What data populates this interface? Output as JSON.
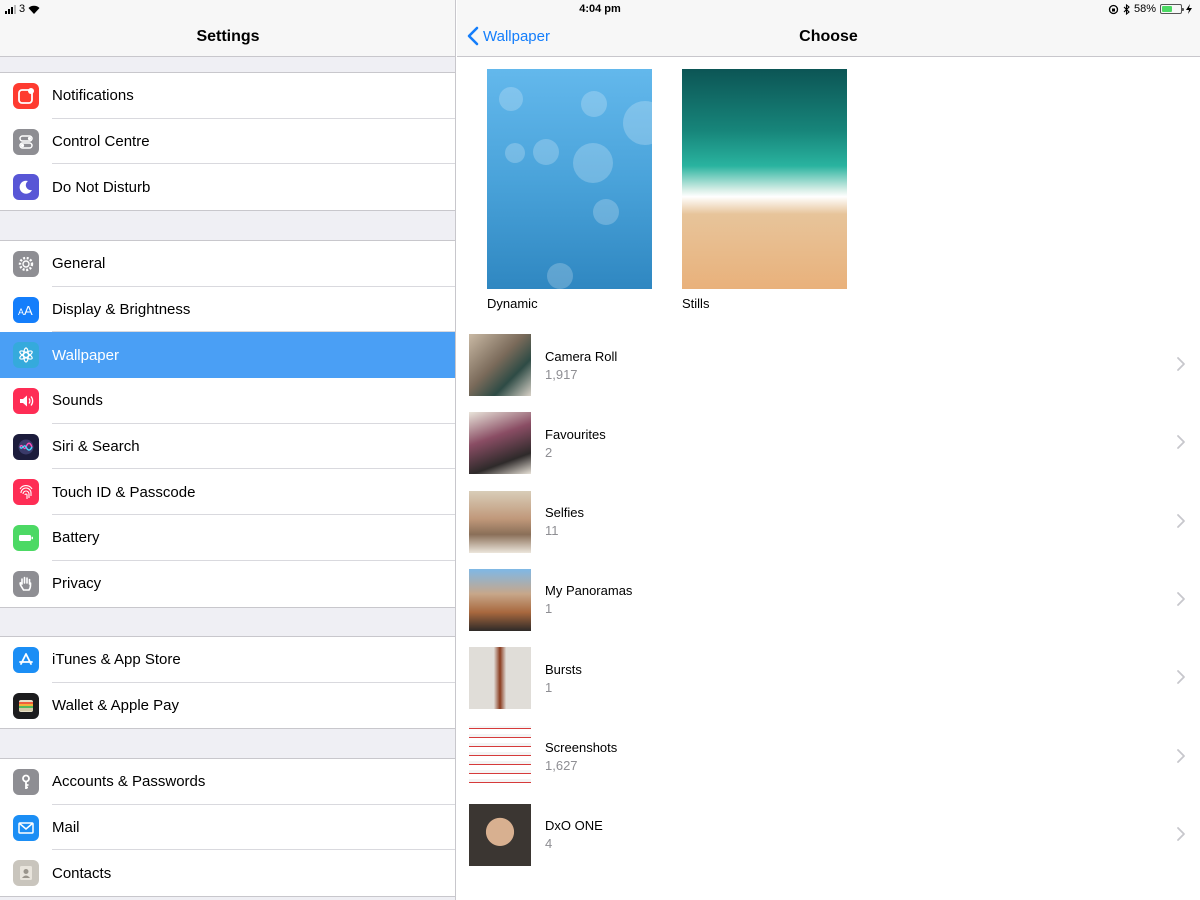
{
  "status": {
    "carrier": "3",
    "time": "4:04 pm",
    "battery": "58%",
    "battery_level": 0.58
  },
  "settings": {
    "title": "Settings",
    "groups": [
      [
        {
          "label": "Notifications",
          "icon": "notifications-icon",
          "color": "#fe3b30"
        },
        {
          "label": "Control Centre",
          "icon": "control-centre-icon",
          "color": "#8e8e93"
        },
        {
          "label": "Do Not Disturb",
          "icon": "moon-icon",
          "color": "#5856d6"
        }
      ],
      [
        {
          "label": "General",
          "icon": "gear-icon",
          "color": "#8e8e93"
        },
        {
          "label": "Display & Brightness",
          "icon": "text-size-icon",
          "color": "#147efb"
        },
        {
          "label": "Wallpaper",
          "icon": "wallpaper-flower-icon",
          "color": "#35aadc",
          "selected": true
        },
        {
          "label": "Sounds",
          "icon": "speaker-icon",
          "color": "#fe2d55"
        },
        {
          "label": "Siri & Search",
          "icon": "siri-icon",
          "color": "#1c1c3c"
        },
        {
          "label": "Touch ID & Passcode",
          "icon": "fingerprint-icon",
          "color": "#fe2d55"
        },
        {
          "label": "Battery",
          "icon": "battery-icon",
          "color": "#4cd964"
        },
        {
          "label": "Privacy",
          "icon": "hand-icon",
          "color": "#8e8e93"
        }
      ],
      [
        {
          "label": "iTunes & App Store",
          "icon": "app-store-icon",
          "color": "#1b8ef5"
        },
        {
          "label": "Wallet & Apple Pay",
          "icon": "wallet-icon",
          "color": "#1c1c1e"
        }
      ],
      [
        {
          "label": "Accounts & Passwords",
          "icon": "key-icon",
          "color": "#8e8e93"
        },
        {
          "label": "Mail",
          "icon": "envelope-icon",
          "color": "#1b8ef5"
        },
        {
          "label": "Contacts",
          "icon": "contacts-icon",
          "color": "#c9c5bd"
        }
      ]
    ]
  },
  "choose": {
    "back_label": "Wallpaper",
    "title": "Choose",
    "wallpapers": [
      {
        "label": "Dynamic"
      },
      {
        "label": "Stills"
      }
    ],
    "albums": [
      {
        "name": "Camera Roll",
        "count": "1,917"
      },
      {
        "name": "Favourites",
        "count": "2"
      },
      {
        "name": "Selfies",
        "count": "11"
      },
      {
        "name": "My Panoramas",
        "count": "1"
      },
      {
        "name": "Bursts",
        "count": "1"
      },
      {
        "name": "Screenshots",
        "count": "1,627"
      },
      {
        "name": "DxO ONE",
        "count": "4"
      }
    ]
  },
  "colors": {
    "accent": "#147efb",
    "selected_row": "#4a9ff5",
    "secondary_text": "#8e8e93"
  }
}
